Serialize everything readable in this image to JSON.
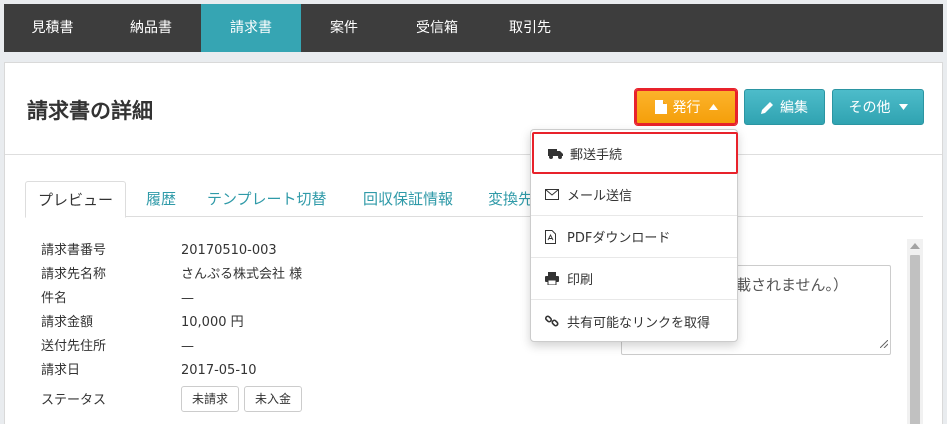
{
  "nav": {
    "items": [
      {
        "label": "見積書",
        "active": false
      },
      {
        "label": "納品書",
        "active": false
      },
      {
        "label": "請求書",
        "active": true
      },
      {
        "label": "案件",
        "active": false
      },
      {
        "label": "受信箱",
        "active": false
      },
      {
        "label": "取引先",
        "active": false
      }
    ]
  },
  "header": {
    "title": "請求書の詳細",
    "issue_label": "発行",
    "edit_label": "編集",
    "other_label": "その他"
  },
  "tabs": [
    {
      "label": "プレビュー",
      "active": true
    },
    {
      "label": "履歴",
      "active": false
    },
    {
      "label": "テンプレート切替",
      "active": false
    },
    {
      "label": "回収保証情報",
      "active": false
    },
    {
      "label": "変換先",
      "active": false
    }
  ],
  "details": [
    {
      "label": "請求書番号",
      "value": "20170510-003"
    },
    {
      "label": "請求先名称",
      "value": "さんぷる株式会社 様"
    },
    {
      "label": "件名",
      "value": "—"
    },
    {
      "label": "請求金額",
      "value": "10,000 円"
    },
    {
      "label": "送付先住所",
      "value": "—"
    },
    {
      "label": "請求日",
      "value": "2017-05-10"
    }
  ],
  "status": {
    "label": "ステータス",
    "badges": [
      "未請求",
      "未入金"
    ]
  },
  "memo": {
    "text": "載されません。）"
  },
  "dropdown": {
    "items": [
      {
        "label": "郵送手続",
        "icon": "truck-icon"
      },
      {
        "label": "メール送信",
        "icon": "envelope-icon"
      },
      {
        "label": "PDFダウンロード",
        "icon": "pdf-file-icon"
      },
      {
        "label": "印刷",
        "icon": "printer-icon"
      },
      {
        "label": "共有可能なリンクを取得",
        "icon": "link-icon"
      }
    ]
  },
  "colors": {
    "nav_bg": "#3d3d3d",
    "nav_active": "#36a5b3",
    "issue_button": "#f7a41a",
    "teal_button": "#36a5b3",
    "highlight_border": "#e8222b",
    "tab_link": "#2f9aa8"
  }
}
